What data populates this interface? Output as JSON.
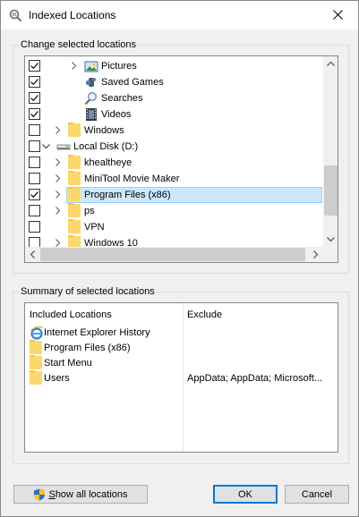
{
  "window": {
    "title": "Indexed Locations"
  },
  "change_group": {
    "label": "Change selected locations",
    "items": [
      {
        "label": "Pictures",
        "checked": true,
        "icon": "pictures-icon",
        "expandable": true
      },
      {
        "label": "Saved Games",
        "checked": true,
        "icon": "saved-games-icon",
        "expandable": false
      },
      {
        "label": "Searches",
        "checked": true,
        "icon": "searches-icon",
        "expandable": false
      },
      {
        "label": "Videos",
        "checked": true,
        "icon": "videos-icon",
        "expandable": false
      },
      {
        "label": "Windows",
        "checked": false,
        "icon": "folder-icon",
        "expandable": true
      },
      {
        "label": "Local Disk (D:)",
        "checked": false,
        "icon": "drive-icon",
        "expandable": true,
        "expanded": true
      },
      {
        "label": "khealtheye",
        "checked": false,
        "icon": "folder-icon",
        "expandable": true
      },
      {
        "label": "MiniTool Movie Maker",
        "checked": false,
        "icon": "folder-icon",
        "expandable": true
      },
      {
        "label": "Program Files (x86)",
        "checked": true,
        "icon": "folder-icon",
        "expandable": true,
        "selected": true
      },
      {
        "label": "ps",
        "checked": false,
        "icon": "folder-icon",
        "expandable": true
      },
      {
        "label": "VPN",
        "checked": false,
        "icon": "folder-icon",
        "expandable": false
      },
      {
        "label": "Windows 10",
        "checked": false,
        "icon": "folder-icon",
        "expandable": true
      }
    ]
  },
  "summary_group": {
    "label": "Summary of selected locations",
    "columns": [
      "Included Locations",
      "Exclude"
    ],
    "rows": [
      {
        "location": "Internet Explorer History",
        "icon": "ie-icon",
        "exclude": ""
      },
      {
        "location": "Program Files (x86)",
        "icon": "folder-icon",
        "exclude": ""
      },
      {
        "location": "Start Menu",
        "icon": "folder-icon",
        "exclude": ""
      },
      {
        "location": "Users",
        "icon": "folder-icon",
        "exclude": "AppData; AppData; Microsoft..."
      }
    ]
  },
  "buttons": {
    "show_all_prefix": "S",
    "show_all_rest": "how all locations",
    "ok": "OK",
    "cancel": "Cancel"
  }
}
